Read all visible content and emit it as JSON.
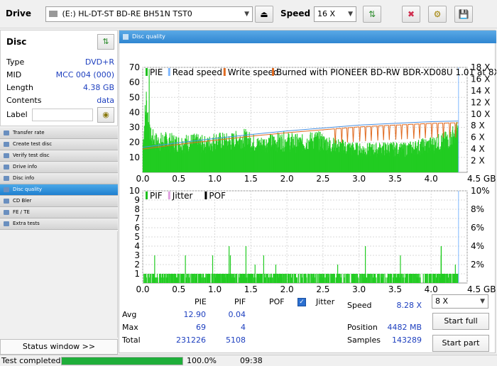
{
  "toolbar": {
    "drive_label": "Drive",
    "drive_value": "(E:)  HL-DT-ST BD-RE  BH51N TST0",
    "speed_label": "Speed",
    "speed_value": "16 X"
  },
  "disc": {
    "title": "Disc",
    "rows": [
      {
        "key": "Type",
        "value": "DVD+R"
      },
      {
        "key": "MID",
        "value": "MCC 004 (000)"
      },
      {
        "key": "Length",
        "value": "4.38 GB"
      },
      {
        "key": "Contents",
        "value": "data"
      }
    ],
    "label_key": "Label"
  },
  "menu": {
    "items": [
      {
        "label": "Transfer rate",
        "active": false
      },
      {
        "label": "Create test disc",
        "active": false
      },
      {
        "label": "Verify test disc",
        "active": false
      },
      {
        "label": "Drive info",
        "active": false
      },
      {
        "label": "Disc info",
        "active": false
      },
      {
        "label": "Disc quality",
        "active": true
      },
      {
        "label": "CD Bler",
        "active": false
      },
      {
        "label": "FE / TE",
        "active": false
      },
      {
        "label": "Extra tests",
        "active": false
      }
    ],
    "status_window": "Status window >>"
  },
  "panel_title": "Disc quality",
  "chart_data": [
    {
      "type": "area",
      "legend": [
        "PIE",
        "Read speed",
        "Write speed",
        "Burned with PIONEER BD-RW  BDR-XD08U 1.01 at 8X"
      ],
      "legend_colors": [
        "#20c020",
        "#7fb8ff",
        "#e06a20",
        "#e06a20"
      ],
      "x_ticks": [
        "0.0",
        "0.5",
        "1.0",
        "1.5",
        "2.0",
        "2.5",
        "3.0",
        "3.5",
        "4.0",
        "4.5 GB"
      ],
      "xlim": [
        0,
        4.5
      ],
      "y_ticks_left": [
        "10",
        "20",
        "30",
        "40",
        "50",
        "60",
        "70"
      ],
      "ylim_left": [
        0,
        70
      ],
      "y_ticks_right": [
        "2 X",
        "4 X",
        "6 X",
        "8 X",
        "10 X",
        "12 X",
        "14 X",
        "16 X",
        "18 X"
      ],
      "ylim_right": [
        0,
        18
      ],
      "pie_envelope": {
        "x": [
          0.0,
          0.05,
          0.1,
          0.2,
          0.3,
          0.5,
          0.7,
          0.9,
          1.0,
          1.2,
          1.4,
          1.6,
          1.8,
          2.0,
          2.2,
          2.4,
          2.6,
          2.8,
          3.0,
          3.2,
          3.4,
          3.6,
          3.8,
          4.0,
          4.2,
          4.38
        ],
        "y": [
          20,
          55,
          28,
          24,
          25,
          23,
          24,
          22,
          25,
          24,
          27,
          22,
          24,
          25,
          23,
          26,
          22,
          20,
          18,
          18,
          19,
          18,
          20,
          22,
          25,
          32
        ]
      },
      "speed_line": {
        "x": [
          0.0,
          0.5,
          1.0,
          1.5,
          2.0,
          2.5,
          3.0,
          3.5,
          4.0,
          4.38
        ],
        "y": [
          4.0,
          4.8,
          5.5,
          6.2,
          6.8,
          7.3,
          7.8,
          8.1,
          8.4,
          8.5
        ]
      }
    },
    {
      "type": "bar",
      "legend": [
        "PIF",
        "Jitter",
        "POF"
      ],
      "legend_colors": [
        "#20c020",
        "#e0a0e0",
        "#000000"
      ],
      "x_ticks": [
        "0.0",
        "0.5",
        "1.0",
        "1.5",
        "2.0",
        "2.5",
        "3.0",
        "3.5",
        "4.0",
        "4.5 GB"
      ],
      "xlim": [
        0,
        4.5
      ],
      "y_ticks_left": [
        "1",
        "2",
        "3",
        "4",
        "5",
        "6",
        "7",
        "8",
        "9",
        "10"
      ],
      "ylim_left": [
        0,
        10
      ],
      "y_ticks_right": [
        "2%",
        "4%",
        "6%",
        "8%",
        "10%"
      ],
      "ylim_right": [
        0,
        10
      ],
      "pif_max": 4
    }
  ],
  "stats": {
    "headers": [
      "PIE",
      "PIF",
      "POF"
    ],
    "jitter_label": "Jitter",
    "rows": [
      {
        "label": "Avg",
        "pie": "12.90",
        "pif": "0.04"
      },
      {
        "label": "Max",
        "pie": "69",
        "pif": "4"
      },
      {
        "label": "Total",
        "pie": "231226",
        "pif": "5108"
      }
    ],
    "speed_label": "Speed",
    "speed_value": "8.28 X",
    "position_label": "Position",
    "position_value": "4482 MB",
    "samples_label": "Samples",
    "samples_value": "143289",
    "speed_select": "8 X",
    "start_full": "Start full",
    "start_part": "Start part"
  },
  "statusbar": {
    "text": "Test completed",
    "progress": 100,
    "percent": "100.0%",
    "time": "09:38"
  }
}
